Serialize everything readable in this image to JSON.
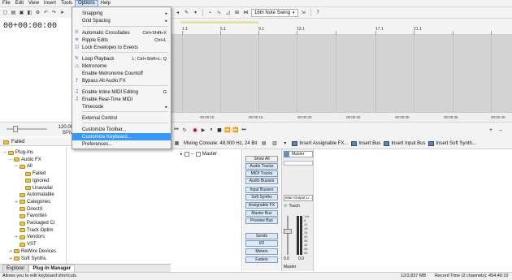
{
  "menu": {
    "items": [
      "File",
      "Edit",
      "View",
      "Insert",
      "Tools",
      "Options",
      "Help"
    ],
    "active_index": 5
  },
  "time_display": "00+00:00:00",
  "tempo": {
    "value": "120.00",
    "unit": "BPM"
  },
  "toolbar": {
    "swing_combo": "16th Note Swing"
  },
  "options_menu": {
    "items": [
      {
        "label": "Snapping",
        "shortcut": "",
        "submenu": true,
        "icon": ""
      },
      {
        "label": "Grid Spacing",
        "shortcut": "",
        "submenu": true,
        "icon": ""
      },
      {
        "label": "Automatic Crossfades",
        "shortcut": "Ctrl+Shift+X",
        "submenu": false,
        "icon": "crossfade-icon"
      },
      {
        "label": "Ripple Edits",
        "shortcut": "Ctrl+L",
        "submenu": false,
        "icon": "ripple-icon"
      },
      {
        "label": "Lock Envelopes to Events",
        "shortcut": "",
        "submenu": false,
        "icon": "lock-icon"
      },
      {
        "label": "Loop Playback",
        "shortcut": "L; Ctrl+Shift+L; Q",
        "submenu": false,
        "icon": "loop-icon"
      },
      {
        "label": "Metronome",
        "shortcut": "",
        "submenu": false,
        "icon": "metronome-icon"
      },
      {
        "label": "Enable Metronome Countoff",
        "shortcut": "",
        "submenu": false,
        "icon": ""
      },
      {
        "label": "Bypass All Audio FX",
        "shortcut": "",
        "submenu": false,
        "icon": "fx-icon"
      },
      {
        "label": "Enable Inline MIDI Editing",
        "shortcut": "G",
        "submenu": false,
        "icon": "midi-icon"
      },
      {
        "label": "Enable Real-Time MIDI",
        "shortcut": "",
        "submenu": false,
        "icon": "midi-icon"
      },
      {
        "label": "Timecode",
        "shortcut": "",
        "submenu": true,
        "icon": ""
      },
      {
        "label": "External Control",
        "shortcut": "",
        "submenu": false,
        "icon": ""
      },
      {
        "label": "Customize Toolbar...",
        "shortcut": "",
        "submenu": false,
        "icon": ""
      },
      {
        "label": "Customize Keyboard...",
        "shortcut": "",
        "submenu": false,
        "icon": ""
      },
      {
        "label": "Preferences...",
        "shortcut": "",
        "submenu": false,
        "icon": ""
      }
    ],
    "highlighted_index": 14
  },
  "ruler": {
    "bars": [
      "1.1",
      "5.1",
      "9.1",
      "13.1",
      "17.1",
      "21.1"
    ]
  },
  "time_ruler": {
    "labels": [
      "00:00:10",
      "00:00:15",
      "00:00:20",
      "00:00:25",
      "00:00:30",
      "00:00:35",
      "00:00:40"
    ]
  },
  "explorer": {
    "status_label": "Failed",
    "tree": [
      {
        "label": "Plug-Ins",
        "depth": 0,
        "expander": "−"
      },
      {
        "label": "Audio FX",
        "depth": 1,
        "expander": "−"
      },
      {
        "label": "All",
        "depth": 2,
        "expander": "−"
      },
      {
        "label": "Failed",
        "depth": 3,
        "expander": ""
      },
      {
        "label": "Ignored",
        "depth": 3,
        "expander": ""
      },
      {
        "label": "Unavailal",
        "depth": 3,
        "expander": ""
      },
      {
        "label": "Automatable",
        "depth": 2,
        "expander": ""
      },
      {
        "label": "Categories",
        "depth": 2,
        "expander": "+"
      },
      {
        "label": "DirectX",
        "depth": 2,
        "expander": ""
      },
      {
        "label": "Favorites",
        "depth": 2,
        "expander": ""
      },
      {
        "label": "Packaged Cl",
        "depth": 2,
        "expander": ""
      },
      {
        "label": "Track Optim",
        "depth": 2,
        "expander": ""
      },
      {
        "label": "Vendors",
        "depth": 2,
        "expander": "+"
      },
      {
        "label": "VST",
        "depth": 2,
        "expander": ""
      },
      {
        "label": "ReWire Devices",
        "depth": 1,
        "expander": "+"
      },
      {
        "label": "Soft Synths",
        "depth": 1,
        "expander": "+"
      }
    ],
    "tabs": [
      "Explorer",
      "Plug-In Manager"
    ],
    "selected_tab": 1
  },
  "mixer": {
    "title": "Mixing Console: 48,000 Hz, 24 Bit",
    "insert_assignable_fx": "Insert Assignable FX...",
    "insert_bus": "Insert Bus",
    "insert_input_bus": "Insert Input Bus",
    "insert_soft_synth": "Insert Soft Synth...",
    "tree_master": "Master",
    "buttons": [
      "Show All",
      "Audio Tracks",
      "MIDI Tracks",
      "Audio Busses",
      "Input Busses",
      "Soft Synths",
      "Assignable FX",
      "Master Bus",
      "Preview Bus",
      "Sends",
      "I/O",
      "Meters",
      "Faders"
    ],
    "strip": {
      "name": "Master",
      "output": "Main Output L/...",
      "mode": "Touch",
      "level_left": "0.0",
      "level_right": "0.0",
      "scale_labels": [
        "-Inf.",
        "6",
        "12",
        "18",
        "24",
        "30",
        "36",
        "42",
        "48",
        "54"
      ],
      "footer": "Master"
    }
  },
  "status": {
    "hint": "Allows you to edit keyboard shortcuts.",
    "memory": "12/3,837 MB",
    "record_time": "Record Time (2 channels): 454:40:10"
  }
}
